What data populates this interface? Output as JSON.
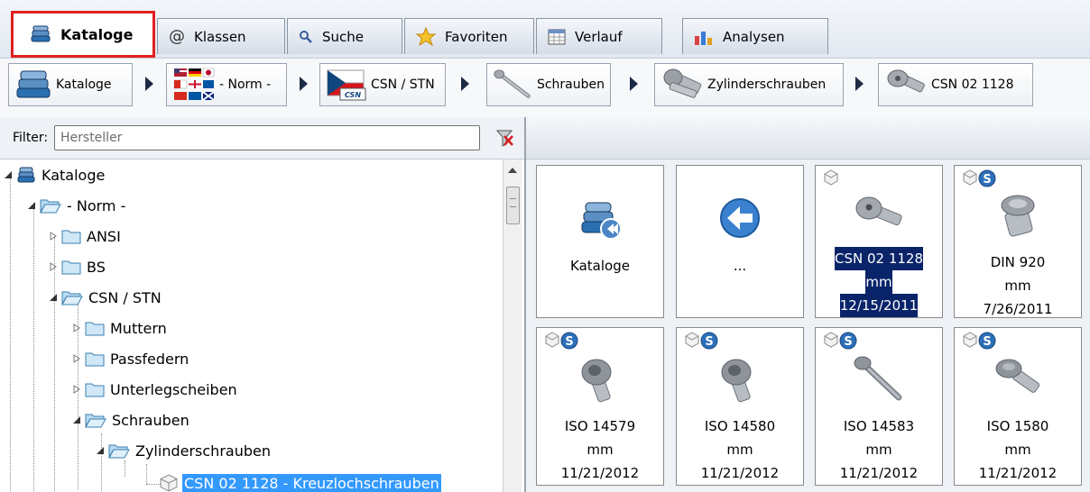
{
  "tabs": [
    {
      "label": "Kataloge",
      "icon": "books-icon",
      "active": true
    },
    {
      "label": "Klassen",
      "icon": "at-icon"
    },
    {
      "label": "Suche",
      "icon": "magnifier-icon"
    },
    {
      "label": "Favoriten",
      "icon": "star-icon"
    },
    {
      "label": "Verlauf",
      "icon": "calendar-icon"
    },
    {
      "label": "Analysen",
      "icon": "bar-chart-icon"
    }
  ],
  "breadcrumb": [
    {
      "label": "Kataloge",
      "icon": "books-icon"
    },
    {
      "label": "- Norm -",
      "icon": "flags-icon"
    },
    {
      "label": "CSN / STN",
      "icon": "czech-flag-icon"
    },
    {
      "label": "Schrauben",
      "icon": "screw-icon"
    },
    {
      "label": "Zylinderschrauben",
      "icon": "cylinder-screw-icon"
    },
    {
      "label": "CSN 02 1128",
      "icon": "cross-hole-screw-icon"
    }
  ],
  "filter": {
    "label": "Filter:",
    "placeholder": "Hersteller"
  },
  "tree": [
    {
      "label": "Kataloge",
      "level": 0,
      "icon": "books-icon"
    },
    {
      "label": "- Norm -",
      "level": 1,
      "icon": "folder-open-icon"
    },
    {
      "label": "ANSI",
      "level": 2,
      "icon": "folder-icon"
    },
    {
      "label": "BS",
      "level": 2,
      "icon": "folder-icon"
    },
    {
      "label": "CSN / STN",
      "level": 2,
      "icon": "folder-open-icon"
    },
    {
      "label": "Muttern",
      "level": 3,
      "icon": "folder-icon"
    },
    {
      "label": "Passfedern",
      "level": 3,
      "icon": "folder-icon"
    },
    {
      "label": "Unterlegscheiben",
      "level": 3,
      "icon": "folder-icon"
    },
    {
      "label": "Schrauben",
      "level": 3,
      "icon": "folder-open-icon"
    },
    {
      "label": "Zylinderschrauben",
      "level": 4,
      "icon": "folder-open-icon"
    },
    {
      "label": "CSN 02 1128 - Kreuzlochschrauben",
      "level": 5,
      "icon": "part-icon",
      "selected": true
    }
  ],
  "cards": [
    {
      "lines": [
        "Kataloge"
      ],
      "pic": "catalog-back-icon"
    },
    {
      "lines": [
        "..."
      ],
      "pic": "back-arrow-icon"
    },
    {
      "lines": [
        "CSN 02 1128",
        "mm",
        "12/15/2011"
      ],
      "pic": "cross-hole-screw-icon",
      "selected": true
    },
    {
      "lines": [
        "DIN 920",
        "mm",
        "7/26/2011"
      ],
      "pic": "short-screw-icon",
      "badge": true
    },
    {
      "lines": [
        "ISO 14579",
        "mm",
        "11/21/2012"
      ],
      "pic": "socket-screw-icon",
      "badge": true
    },
    {
      "lines": [
        "ISO 14580",
        "mm",
        "11/21/2012"
      ],
      "pic": "socket-screw-icon",
      "badge": true
    },
    {
      "lines": [
        "ISO 14583",
        "mm",
        "11/21/2012"
      ],
      "pic": "long-screw-icon",
      "badge": true
    },
    {
      "lines": [
        "ISO 1580",
        "mm",
        "11/21/2012"
      ],
      "pic": "pan-screw-icon",
      "badge": true
    }
  ],
  "colors": {
    "active_tab_border": "#e02020",
    "tree_selection": "#3399ff",
    "card_selection": "#0a246a"
  }
}
